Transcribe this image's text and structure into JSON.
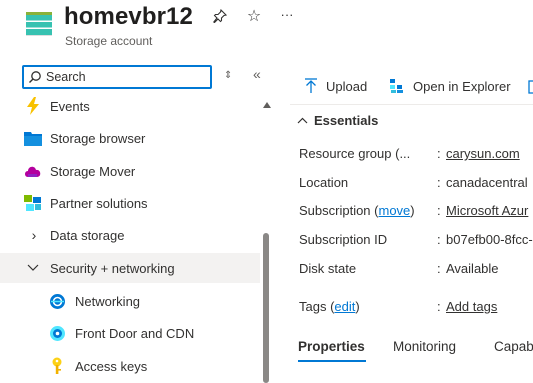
{
  "resource": {
    "title": "homevbr12",
    "subtitle": "Storage account"
  },
  "header_actions": {
    "pin_icon": "pin-icon",
    "favorite_icon": "star-icon",
    "more_label": "···"
  },
  "sidebar": {
    "search_placeholder": "Search",
    "items": [
      {
        "label": "Events",
        "icon": "lightning-icon"
      },
      {
        "label": "Storage browser",
        "icon": "storage-browser-icon"
      },
      {
        "label": "Storage Mover",
        "icon": "cloud-icon"
      },
      {
        "label": "Partner solutions",
        "icon": "partner-solutions-icon"
      },
      {
        "label": "Data storage",
        "icon": "chevron-right-icon"
      },
      {
        "label": "Security + networking",
        "icon": "chevron-down-icon"
      },
      {
        "label": "Networking",
        "icon": "networking-icon"
      },
      {
        "label": "Front Door and CDN",
        "icon": "front-door-icon"
      },
      {
        "label": "Access keys",
        "icon": "key-icon"
      }
    ]
  },
  "toolbar": {
    "upload_label": "Upload",
    "explorer_label": "Open in Explorer"
  },
  "essentials": {
    "heading": "Essentials",
    "rows": [
      {
        "key": "Resource group (...",
        "value": "carysun.com",
        "value_link": true
      },
      {
        "key": "Location",
        "value": "canadacentral"
      },
      {
        "key_prefix": "Subscription (",
        "key_link": "move",
        "key_suffix": ")",
        "value": "Microsoft Azur",
        "value_link": true
      },
      {
        "key": "Subscription ID",
        "value": "b07efb00-8fcc-"
      },
      {
        "key": "Disk state",
        "value": "Available"
      },
      {
        "key_prefix": "Tags (",
        "key_link": "edit",
        "key_suffix": ")",
        "value": "Add tags",
        "value_link": true
      }
    ]
  },
  "tabs": [
    {
      "label": "Properties",
      "active": true
    },
    {
      "label": "Monitoring",
      "active": false
    },
    {
      "label": "Capab",
      "active": false
    }
  ],
  "colors": {
    "accent": "#0078d4",
    "selected_bg": "#f3f2f1"
  }
}
